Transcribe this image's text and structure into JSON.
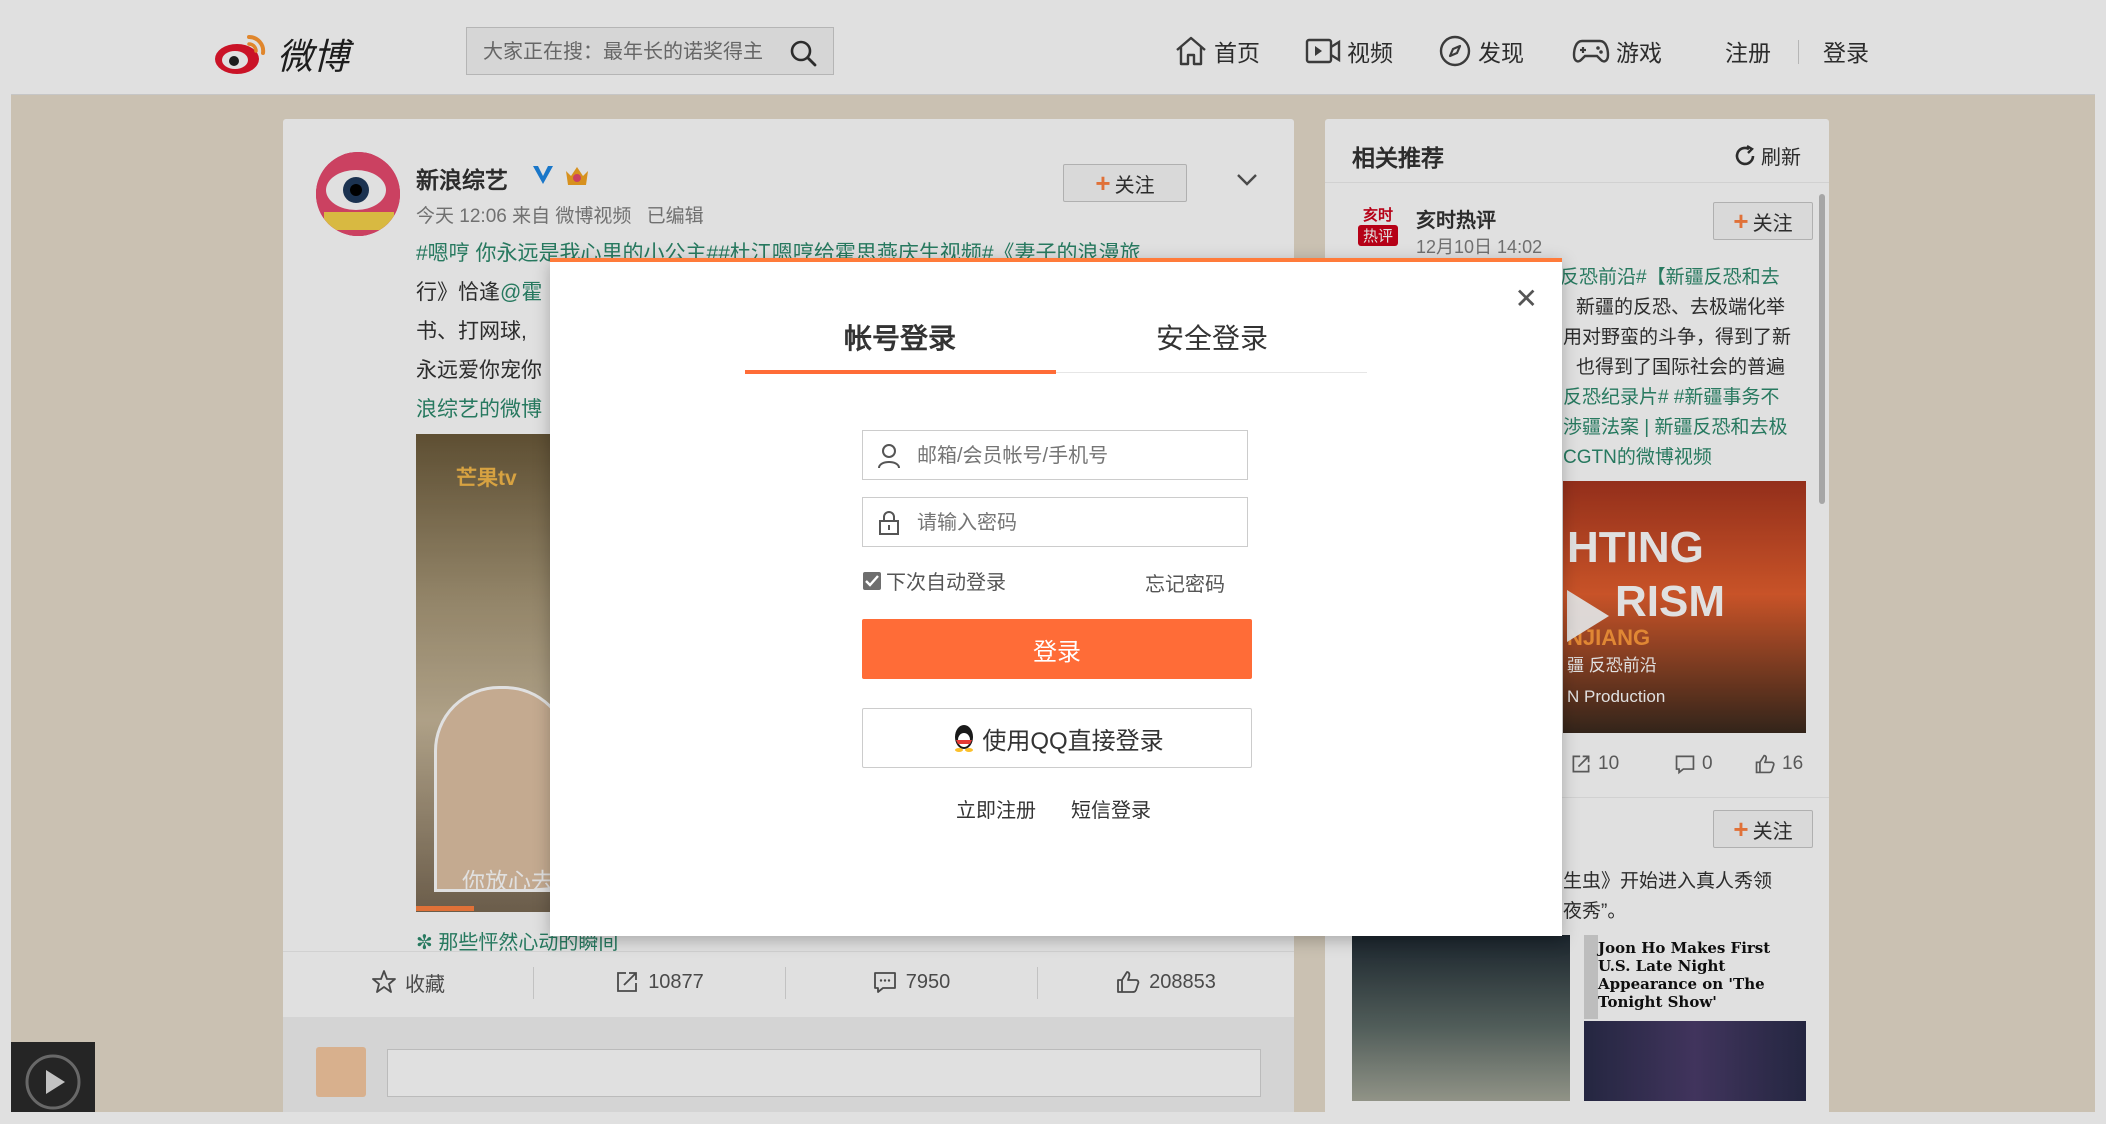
{
  "header": {
    "logo_text": "微博",
    "search_placeholder": "大家正在搜：最年长的诺奖得主",
    "nav": {
      "home": "首页",
      "video": "视频",
      "discover": "发现",
      "game": "游戏",
      "register": "注册",
      "login": "登录"
    }
  },
  "post": {
    "author": "新浪综艺",
    "meta": "今天 12:06 来自 微博视频",
    "edited": "已编辑",
    "follow_label": "关注",
    "text_line1": "#嗯哼 你永远是我心里的小公主##杜江嗯哼给霍思燕庆生视频#《妻子的浪漫旅",
    "text_line2_a": "行》恰逢",
    "text_line2_b": "@霍",
    "text_line3": "书、打网球,",
    "text_line4": "永远爱你宠你",
    "text_line5": "浪综艺的微博",
    "video_logo": "芒果tv",
    "video_subtitle": "你放心去",
    "caption": "那些怦然心动的瞬间",
    "actions": {
      "favorite": "收藏",
      "repost": "10877",
      "comment": "7950",
      "like": "208853"
    }
  },
  "sidebar": {
    "title": "相关推荐",
    "refresh": "刷新",
    "item1": {
      "badge_top": "亥时",
      "badge_bottom": "热评",
      "name": "亥时热评",
      "time": "12月10日 14:02",
      "follow": "关注",
      "lines": [
        "反恐前沿#【新疆反恐和去",
        "新疆的反恐、去极端化举",
        "用对野蛮的斗争，得到了新",
        "也得到了国际社会的普遍",
        "反恐纪录片# #新疆事务不",
        "渉疆法案 | 新疆反恐和去极",
        "CGTN的微博视频"
      ],
      "thumb_text1": "HTING",
      "thumb_text2": "RISM",
      "thumb_text3": "NJIANG",
      "thumb_text4": "疆 反恐前沿",
      "thumb_text5": "N Production",
      "repost": "10",
      "comment": "0",
      "like": "16"
    },
    "item2": {
      "follow": "关注",
      "line1": "生虫》开始进入真人秀领",
      "line2": "夜秀”。",
      "news_headline": "Joon Ho Makes First U.S. Late Night Appearance on 'The Tonight Show'"
    }
  },
  "modal": {
    "tab_account": "帐号登录",
    "tab_secure": "安全登录",
    "username_placeholder": "邮箱/会员帐号/手机号",
    "password_placeholder": "请输入密码",
    "remember_label": "下次自动登录",
    "forgot_label": "忘记密码",
    "login_button": "登录",
    "qq_button": "使用QQ直接登录",
    "register_link": "立即注册",
    "sms_link": "短信登录",
    "close_glyph": "✕"
  },
  "colors": {
    "accent": "#ff6c37",
    "link_green": "#2d8a6d",
    "page_bg": "#e6dccb"
  }
}
